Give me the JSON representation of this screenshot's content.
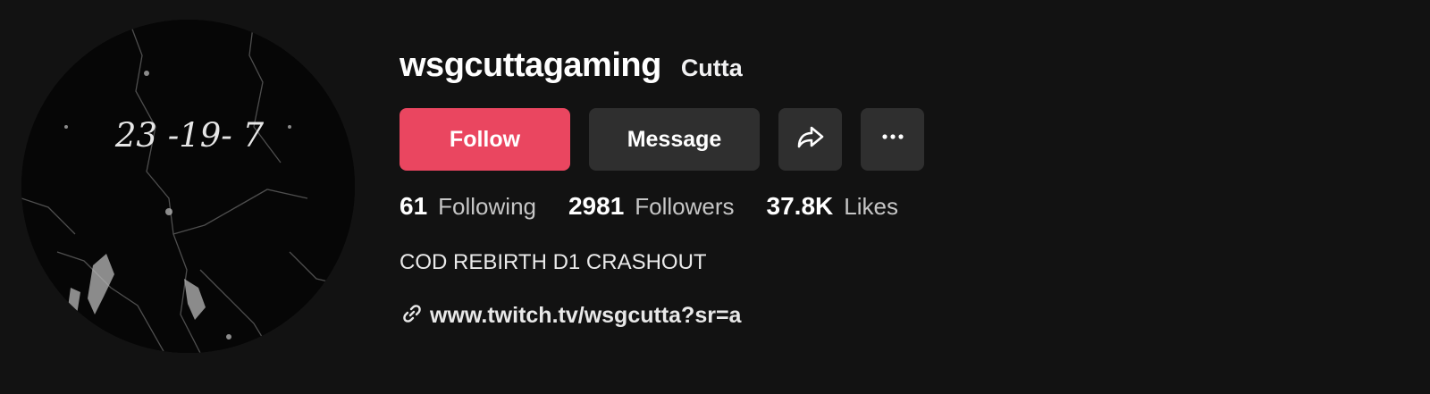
{
  "profile": {
    "username": "wsgcuttagaming",
    "nickname": "Cutta",
    "avatar_text": "23 -19- 7",
    "bio": "COD REBIRTH D1 CRASHOUT",
    "link": "www.twitch.tv/wsgcutta?sr=a"
  },
  "actions": {
    "follow_label": "Follow",
    "message_label": "Message",
    "share_icon": "share-icon",
    "more_icon": "more-icon"
  },
  "stats": [
    {
      "value": "61",
      "label": "Following"
    },
    {
      "value": "2981",
      "label": "Followers"
    },
    {
      "value": "37.8K",
      "label": "Likes"
    }
  ],
  "colors": {
    "background": "#121212",
    "follow_button": "#ea4660",
    "secondary_button": "#2f2f2f"
  }
}
